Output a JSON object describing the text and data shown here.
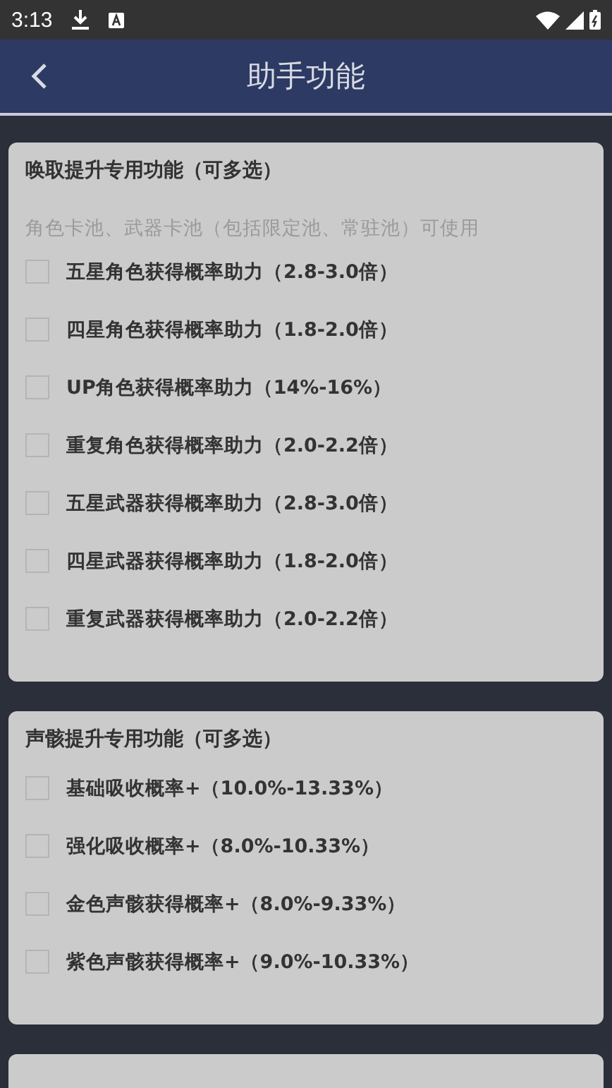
{
  "status_bar": {
    "time": "3:13"
  },
  "header": {
    "title": "助手功能"
  },
  "sections": [
    {
      "title": "唤取提升专用功能（可多选）",
      "note": "角色卡池、武器卡池（包括限定池、常驻池）可使用",
      "options": [
        {
          "label": "五星角色获得概率助力（2.8-3.0倍）",
          "checked": false
        },
        {
          "label": "四星角色获得概率助力（1.8-2.0倍）",
          "checked": false
        },
        {
          "label": "UP角色获得概率助力（14%-16%）",
          "checked": false
        },
        {
          "label": "重复角色获得概率助力（2.0-2.2倍）",
          "checked": false
        },
        {
          "label": "五星武器获得概率助力（2.8-3.0倍）",
          "checked": false
        },
        {
          "label": "四星武器获得概率助力（1.8-2.0倍）",
          "checked": false
        },
        {
          "label": "重复武器获得概率助力（2.0-2.2倍）",
          "checked": false
        }
      ]
    },
    {
      "title": "声骸提升专用功能（可多选）",
      "options": [
        {
          "label": "基础吸收概率+（10.0%-13.33%）",
          "checked": false
        },
        {
          "label": "强化吸收概率+（8.0%-10.33%）",
          "checked": false
        },
        {
          "label": "金色声骸获得概率+（8.0%-9.33%）",
          "checked": false
        },
        {
          "label": "紫色声骸获得概率+（9.0%-10.33%）",
          "checked": false
        }
      ]
    }
  ]
}
